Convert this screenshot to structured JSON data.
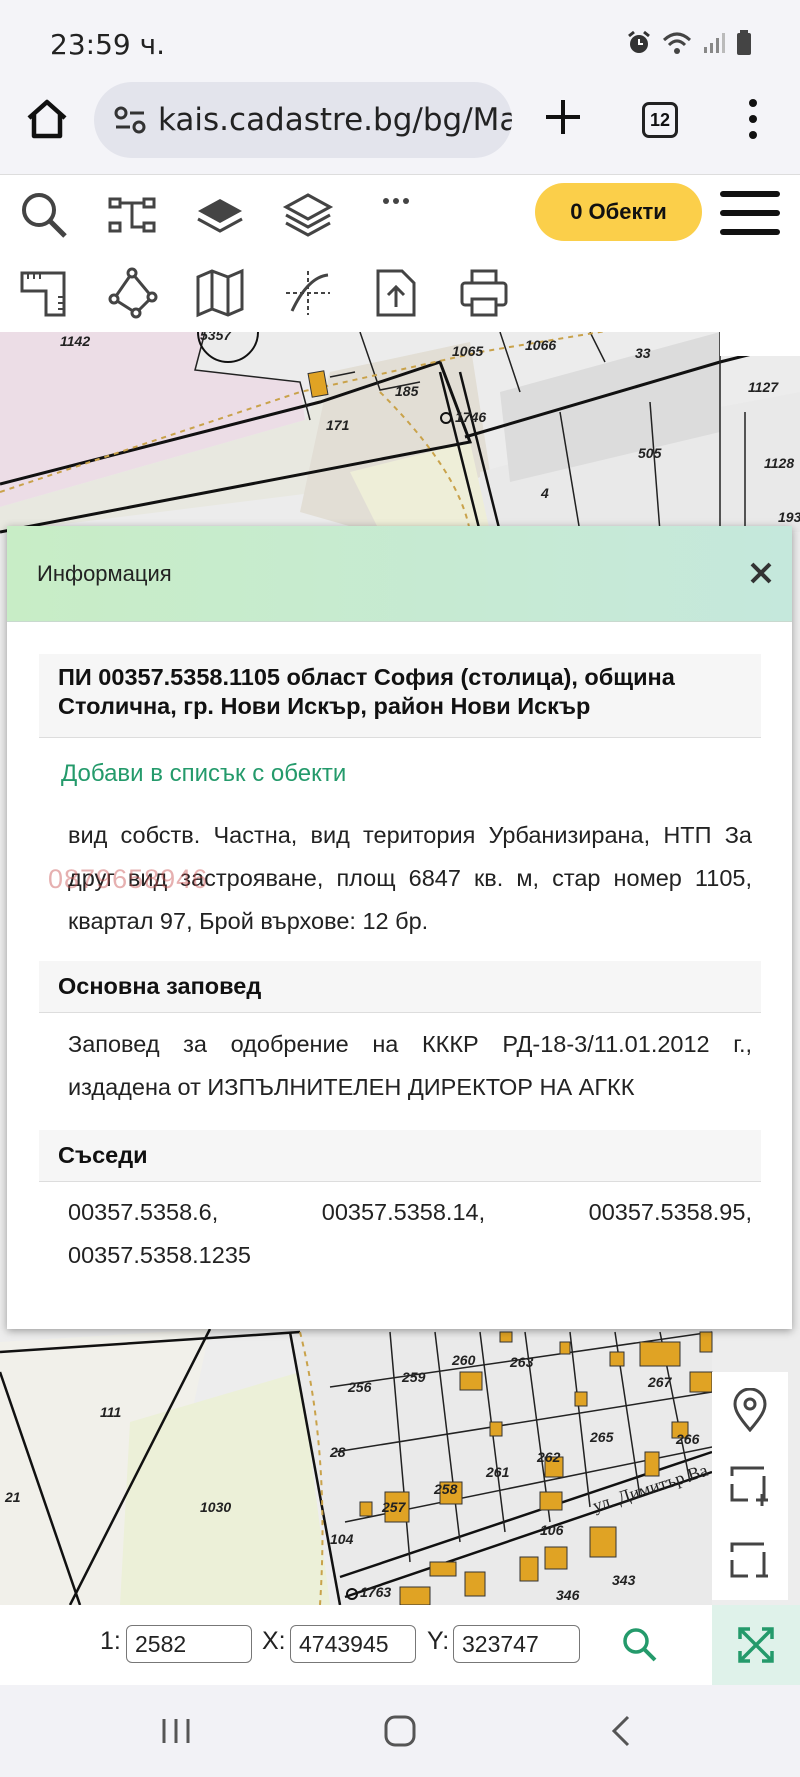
{
  "status": {
    "time": "23:59 ч."
  },
  "browser": {
    "url": "kais.cadastre.bg/bg/Map",
    "tab_count": "12"
  },
  "toolbar": {
    "objects_label": "0 Обекти"
  },
  "map_labels": {
    "p1142": "1142",
    "p185": "185",
    "p171": "171",
    "p1746": "1746",
    "p505": "505",
    "p4": "4",
    "p1066": "1066",
    "p1065": "1065",
    "p1127": "1127",
    "p1128": "1128",
    "p33": "33",
    "p19": "193",
    "p5357": "5357",
    "p111": "111",
    "p21": "21",
    "p1030": "1030",
    "p256": "256",
    "p259": "259",
    "p260": "260",
    "p263": "263",
    "p267": "267",
    "p265": "265",
    "p262": "262",
    "p261": "261",
    "p258": "258",
    "p266": "266",
    "p257": "257",
    "p28": "28",
    "p104": "104",
    "p106": "106",
    "p343": "343",
    "p346": "346",
    "p1763": "1763",
    "street": "ул. Димитър Ва"
  },
  "dialog": {
    "title": "Информация",
    "heading": "ПИ 00357.5358.1105 област София (столица), община Столична, гр. Нови Искър, район Нови Искър",
    "add_link": "Добави в списък с обекти",
    "description": "вид собств. Частна, вид територия Урбанизирана, НТП За друг вид застрояване, площ 6847 кв. м, стар номер 1105, квартал 97, Брой върхове: 12 бр.",
    "watermark": "0879658946",
    "order_title": "Основна заповед",
    "order_text": "Заповед за одобрение на КККР РД-18-3/11.01.2012 г., издадена от ИЗПЪЛНИТЕЛЕН ДИРЕКТОР НА АГКК",
    "neighbors_title": "Съседи",
    "neighbors": [
      "00357.5358.6,",
      "00357.5358.14,",
      "00357.5358.95,",
      "00357.5358.1235"
    ]
  },
  "scale": {
    "scale_label": "1:",
    "scale_value": "2582",
    "x_label": "X:",
    "x_value": "4743945",
    "y_label": "Y:",
    "y_value": "323747"
  }
}
